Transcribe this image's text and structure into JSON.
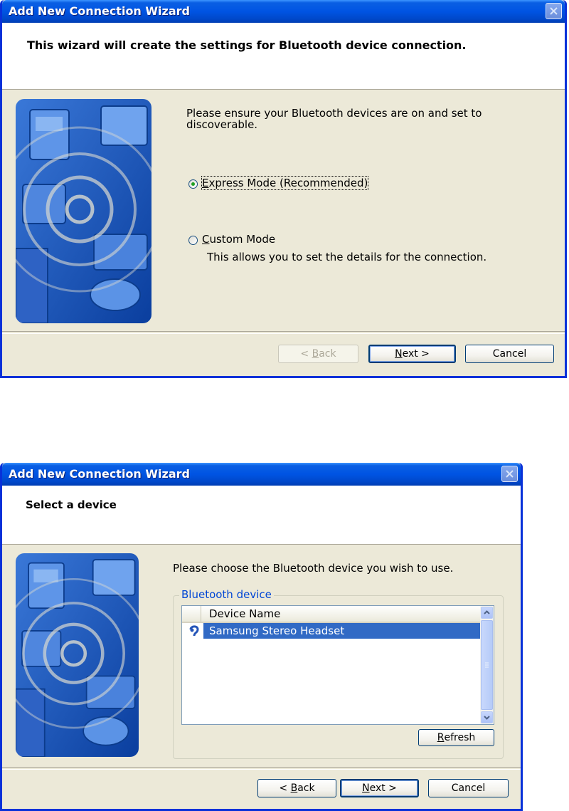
{
  "colors": {
    "titlebar": "#0054E3",
    "face": "#ECE9D8",
    "selection": "#316AC5",
    "group_label": "#0046D5",
    "radio_dot": "#21A121"
  },
  "dialog1": {
    "title": "Add New Connection Wizard",
    "header": "This wizard will create the settings for Bluetooth device connection.",
    "instruction_line1": "Please ensure your Bluetooth devices are on and set to",
    "instruction_line2": "discoverable.",
    "express_mode": {
      "label": "Express Mode (Recommended)",
      "access_key": "E",
      "rest": "xpress Mode (Recommended)",
      "selected": true
    },
    "custom_mode": {
      "label": "Custom Mode",
      "access_key": "C",
      "rest": "ustom Mode",
      "selected": false,
      "description": "This allows you to set the details for the connection."
    },
    "buttons": {
      "back": {
        "pre": "< ",
        "key": "B",
        "post": "ack",
        "enabled": false
      },
      "next": {
        "pre": "",
        "key": "N",
        "post": "ext >",
        "default": true
      },
      "cancel": "Cancel"
    }
  },
  "dialog2": {
    "title": "Add New Connection Wizard",
    "header": "Select a device",
    "instruction": "Please choose the Bluetooth device you wish to use.",
    "group_label": "Bluetooth device",
    "list": {
      "column_header": "Device Name",
      "rows": [
        {
          "name": "Samsung Stereo Headset",
          "icon": "bluetooth-headset-icon",
          "selected": true
        }
      ]
    },
    "refresh_button": {
      "key": "R",
      "post": "efresh"
    },
    "buttons": {
      "back": {
        "pre": "< ",
        "key": "B",
        "post": "ack"
      },
      "next": {
        "pre": "",
        "key": "N",
        "post": "ext >"
      },
      "cancel": "Cancel"
    }
  }
}
